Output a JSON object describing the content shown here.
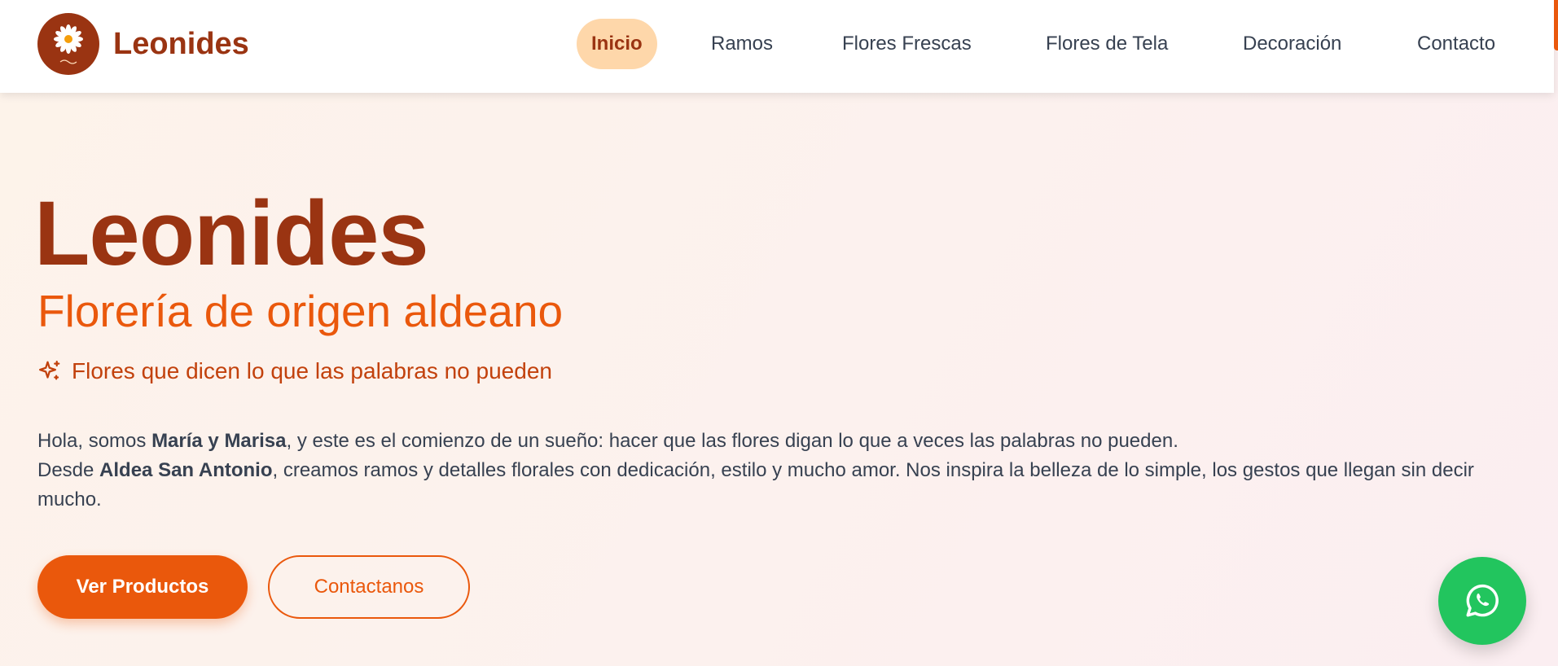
{
  "header": {
    "brand": "Leonides",
    "nav": [
      {
        "label": "Inicio",
        "active": true
      },
      {
        "label": "Ramos"
      },
      {
        "label": "Flores Frescas"
      },
      {
        "label": "Flores de Tela"
      },
      {
        "label": "Decoración"
      },
      {
        "label": "Contacto"
      }
    ]
  },
  "hero": {
    "title": "Leonides",
    "subtitle": "Florería de origen aldeano",
    "tagline": "Flores que dicen lo que las palabras no pueden",
    "paragraph1": {
      "before": "Hola, somos ",
      "bold": "María y Marisa",
      "after": ", y este es el comienzo de un sueño: hacer que las flores digan lo que a veces las palabras no pueden."
    },
    "paragraph2": {
      "before": "Desde ",
      "bold": "Aldea San Antonio",
      "after": ", creamos ramos y detalles florales con dedicación, estilo y mucho amor. Nos inspira la belleza de lo simple, los gestos que llegan sin decir mucho."
    },
    "primary_button": "Ver Productos",
    "secondary_button": "Contactanos"
  },
  "icons": {
    "logo": "daisy-logo-icon",
    "tagline": "sparkles-icon",
    "floating": "whatsapp-icon"
  },
  "colors": {
    "brand_dark": "#9a3412",
    "accent": "#ea580c",
    "nav_active_bg": "#fed7aa",
    "whatsapp": "#22c55e"
  }
}
